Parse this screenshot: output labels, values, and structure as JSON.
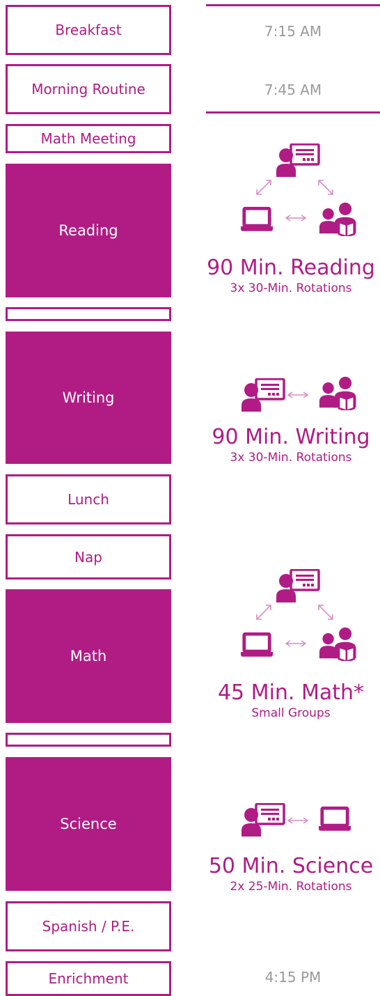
{
  "blocks": {
    "breakfast": "Breakfast",
    "morning_routine": "Morning Routine",
    "math_meeting": "Math Meeting",
    "reading": "Reading",
    "writing": "Writing",
    "lunch": "Lunch",
    "nap": "Nap",
    "math": "Math",
    "science": "Science",
    "spanish_pe": "Spanish / P.E.",
    "enrichment": "Enrichment"
  },
  "times": {
    "breakfast": "7:15 AM",
    "morning_routine": "7:45 AM",
    "enrichment": "4:15 PM"
  },
  "captions": {
    "reading": {
      "title": "90 Min. Reading",
      "sub": "3x 30-Min. Rotations"
    },
    "writing": {
      "title": "90 Min. Writing",
      "sub": "3x 30-Min. Rotations"
    },
    "math": {
      "title": "45 Min. Math*",
      "sub": "Small Groups"
    },
    "science": {
      "title": "50 Min. Science",
      "sub": "2x 25-Min. Rotations"
    }
  },
  "icons": {
    "teacher": "teacher-board-icon",
    "computer": "laptop-icon",
    "small_group": "students-reading-icon",
    "arrow": "double-arrow-icon"
  },
  "colors": {
    "accent": "#b01c84",
    "light_accent": "#d98cc4",
    "time_gray": "#9a9a9a"
  }
}
